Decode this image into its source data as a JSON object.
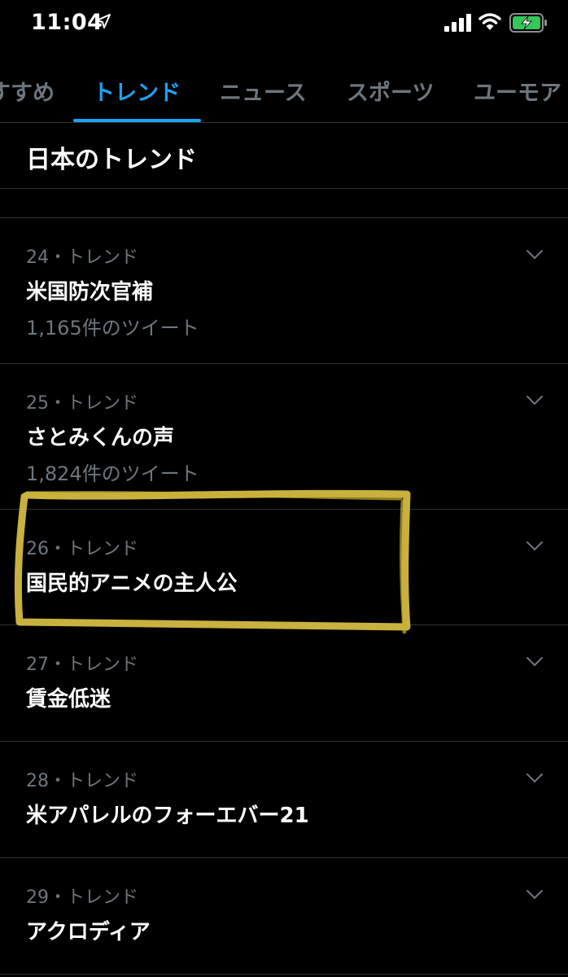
{
  "status_bar": {
    "time": "11:04",
    "icons": [
      "location-arrow-icon",
      "signal-bars-icon",
      "wifi-icon",
      "battery-charging-icon"
    ],
    "battery_color": "#34c759"
  },
  "tabs": [
    {
      "label": "すすめ",
      "active": false
    },
    {
      "label": "トレンド",
      "active": true
    },
    {
      "label": "ニュース",
      "active": false
    },
    {
      "label": "スポーツ",
      "active": false
    },
    {
      "label": "ユーモア",
      "active": false
    }
  ],
  "section": {
    "title": "日本のトレンド"
  },
  "trends": [
    {
      "meta": "24・トレンド",
      "name": "米国防次官補",
      "count": "1,165件のツイート"
    },
    {
      "meta": "25・トレンド",
      "name": "さとみくんの声",
      "count": "1,824件のツイート"
    },
    {
      "meta": "26・トレンド",
      "name": "国民的アニメの主人公",
      "count": ""
    },
    {
      "meta": "27・トレンド",
      "name": "賃金低迷",
      "count": ""
    },
    {
      "meta": "28・トレンド",
      "name": "米アパレルのフォーエバー21",
      "count": ""
    },
    {
      "meta": "29・トレンド",
      "name": "アクロディア",
      "count": ""
    }
  ],
  "colors": {
    "background": "#000000",
    "accent": "#1da1f2",
    "secondary_text": "#6e767d",
    "divider": "#2f3336",
    "highlight_marker": "#d9c043"
  }
}
